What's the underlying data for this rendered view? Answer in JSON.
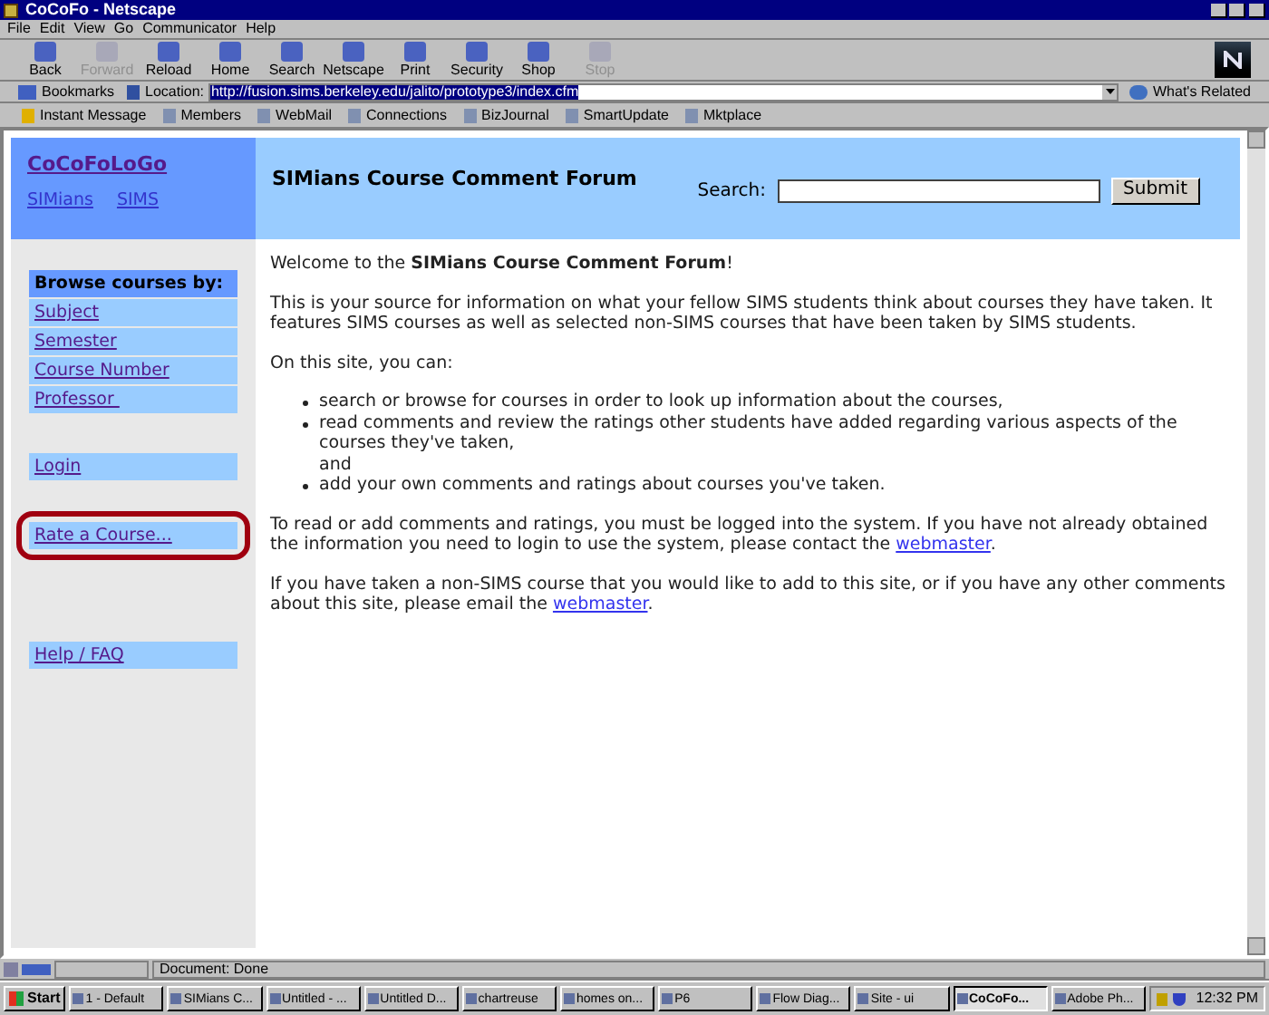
{
  "window": {
    "title": "CoCoFo - Netscape"
  },
  "menu": [
    "File",
    "Edit",
    "View",
    "Go",
    "Communicator",
    "Help"
  ],
  "toolbar": [
    {
      "label": "Back",
      "disabled": false
    },
    {
      "label": "Forward",
      "disabled": true
    },
    {
      "label": "Reload",
      "disabled": false
    },
    {
      "label": "Home",
      "disabled": false
    },
    {
      "label": "Search",
      "disabled": false
    },
    {
      "label": "Netscape",
      "disabled": false
    },
    {
      "label": "Print",
      "disabled": false
    },
    {
      "label": "Security",
      "disabled": false
    },
    {
      "label": "Shop",
      "disabled": false
    },
    {
      "label": "Stop",
      "disabled": true
    }
  ],
  "location_bar": {
    "bookmarks": "Bookmarks",
    "label": "Location:",
    "url": "http://fusion.sims.berkeley.edu/jalito/prototype3/index.cfm",
    "related": "What's Related"
  },
  "personal_bar": [
    "Instant Message",
    "Members",
    "WebMail",
    "Connections",
    "BizJournal",
    "SmartUpdate",
    "Mktplace"
  ],
  "page": {
    "logo": "CoCoFoLoGo",
    "header_links": [
      "SIMians",
      "SIMS"
    ],
    "title": "SIMians Course Comment Forum",
    "search": {
      "label": "Search:",
      "button": "Submit"
    },
    "sidebar": {
      "heading": "Browse courses by:",
      "browse": [
        "Subject",
        "Semester",
        "Course Number",
        "Professor "
      ],
      "links": [
        {
          "label": "Login",
          "highlighted": false
        },
        {
          "label": "Rate a Course...",
          "highlighted": true
        },
        {
          "label": "Help / FAQ",
          "highlighted": false
        }
      ]
    },
    "content": [
      {
        "kind": "text",
        "text": "Welcome to the **SIMians Course Comment Forum**!"
      },
      {
        "kind": "text",
        "text": "This is your source for information on what your fellow SIMS students think about courses they have taken. It features SIMS courses as well as selected non-SIMS courses that have been taken by SIMS students."
      },
      {
        "kind": "text",
        "text": "On this site, you can:"
      },
      {
        "kind": "list",
        "items": [
          "search or browse for courses in order to look up information about the courses,",
          "read comments and review the ratings other students have added regarding various aspects of the courses they've taken,\nand",
          "add your own comments and ratings about courses you've taken."
        ]
      },
      {
        "kind": "link",
        "text": "To read or add comments and ratings, you must be logged into the system. If you have not already obtained the information you need to login to use the system, please contact the ",
        "link": "webmaster",
        "after": "."
      },
      {
        "kind": "link",
        "text": "If you have taken a non-SIMS course that you would like to add to this site, or if you have any other comments about this site, please email the ",
        "link": "webmaster",
        "after": "."
      }
    ]
  },
  "status_bar": {
    "text": "Document: Done"
  },
  "taskbar": {
    "start": "Start",
    "items": [
      {
        "label": "1 - Default",
        "selected": false
      },
      {
        "label": "SIMians C...",
        "selected": false
      },
      {
        "label": "Untitled - ...",
        "selected": false
      },
      {
        "label": "Untitled D...",
        "selected": false
      },
      {
        "label": "chartreuse",
        "selected": false
      },
      {
        "label": "homes on...",
        "selected": false
      },
      {
        "label": "P6",
        "selected": false
      },
      {
        "label": "Flow Diag...",
        "selected": false
      },
      {
        "label": "Site - ui",
        "selected": false
      },
      {
        "label": "CoCoFo...",
        "selected": true
      },
      {
        "label": "Adobe Ph...",
        "selected": false
      }
    ],
    "clock": "12:32 PM"
  }
}
